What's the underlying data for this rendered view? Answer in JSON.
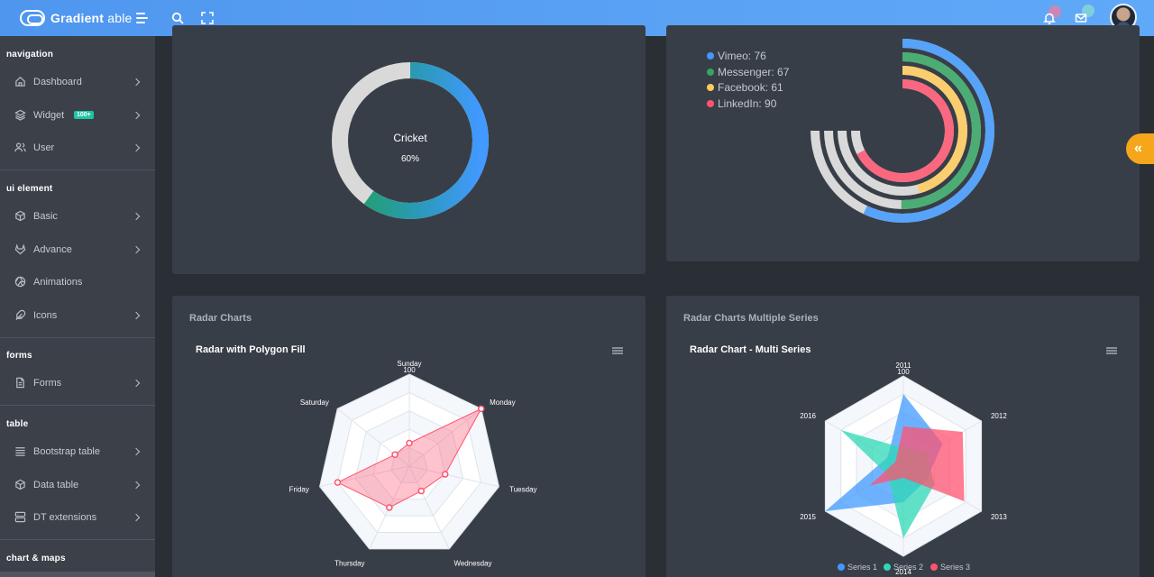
{
  "brand": {
    "name_bold": "Gradient",
    "name_light": " able"
  },
  "header": {
    "icons": [
      "menu-icon",
      "search-icon",
      "fullscreen-icon",
      "bell-icon",
      "mail-icon"
    ]
  },
  "sidebar": {
    "sections": [
      {
        "title": "navigation",
        "items": [
          {
            "label": "Dashboard",
            "icon": "home-icon"
          },
          {
            "label": "Widget",
            "icon": "layers-icon",
            "badge": "100+"
          },
          {
            "label": "User",
            "icon": "users-icon"
          }
        ]
      },
      {
        "title": "ui element",
        "items": [
          {
            "label": "Basic",
            "icon": "box-icon"
          },
          {
            "label": "Advance",
            "icon": "gitlab-icon"
          },
          {
            "label": "Animations",
            "icon": "aperture-icon"
          },
          {
            "label": "Icons",
            "icon": "feather-icon"
          }
        ]
      },
      {
        "title": "forms",
        "items": [
          {
            "label": "Forms",
            "icon": "file-text-icon"
          }
        ]
      },
      {
        "title": "table",
        "items": [
          {
            "label": "Bootstrap table",
            "icon": "align-justify-icon"
          },
          {
            "label": "Data table",
            "icon": "box-icon"
          },
          {
            "label": "DT extensions",
            "icon": "server-icon"
          }
        ]
      },
      {
        "title": "chart & maps",
        "items": []
      }
    ]
  },
  "colors": {
    "accent_blue": "#4099ff",
    "green": "#2ed8b6",
    "messenger_green": "#33a562",
    "facebook_yellow": "#ffcb5c",
    "linkedin_red": "#ff5370",
    "track_gray": "#d9d9d9",
    "float_orange": "#f6a61b"
  },
  "cards": {
    "radar_single": {
      "title": "Radar Charts",
      "chart_title": "Radar with Polygon Fill"
    },
    "radar_multi": {
      "title": "Radar Charts Multiple Series",
      "chart_title": "Radar Chart - Multi Series"
    }
  },
  "chart_data": [
    {
      "type": "pie",
      "variant": "donut",
      "center_label": "Cricket",
      "center_value": "60%",
      "values": [
        60
      ]
    },
    {
      "type": "pie",
      "variant": "radial-bar",
      "series": [
        {
          "name": "Vimeo",
          "label": "Vimeo: 76",
          "value": 76,
          "color": "#4099ff"
        },
        {
          "name": "Messenger",
          "label": "Messenger: 67",
          "value": 67,
          "color": "#33a562"
        },
        {
          "name": "Facebook",
          "label": "Facebook: 61",
          "value": 61,
          "color": "#ffcb5c"
        },
        {
          "name": "LinkedIn",
          "label": "LinkedIn: 90",
          "value": 90,
          "color": "#ff5370"
        }
      ],
      "legend": "top-left"
    },
    {
      "type": "radar",
      "categories": [
        "Sunday",
        "Monday",
        "Tuesday",
        "Wednesday",
        "Thursday",
        "Friday",
        "Saturday"
      ],
      "series": [
        {
          "values": [
            25,
            100,
            40,
            30,
            50,
            80,
            20
          ]
        }
      ],
      "ylim": [
        0,
        100
      ],
      "max_tick": "100"
    },
    {
      "type": "radar",
      "categories": [
        "2011",
        "2012",
        "2013",
        "2014",
        "2015",
        "2016"
      ],
      "series": [
        {
          "name": "Series 1",
          "values": [
            80,
            50,
            30,
            40,
            100,
            20
          ],
          "color": "#4099ff"
        },
        {
          "name": "Series 2",
          "values": [
            20,
            30,
            40,
            80,
            20,
            80
          ],
          "color": "#2ed8b6"
        },
        {
          "name": "Series 3",
          "values": [
            44,
            76,
            78,
            13,
            43,
            10
          ],
          "color": "#ff5370"
        }
      ],
      "ylim": [
        0,
        100
      ],
      "max_tick": "100",
      "legend": "bottom"
    }
  ]
}
